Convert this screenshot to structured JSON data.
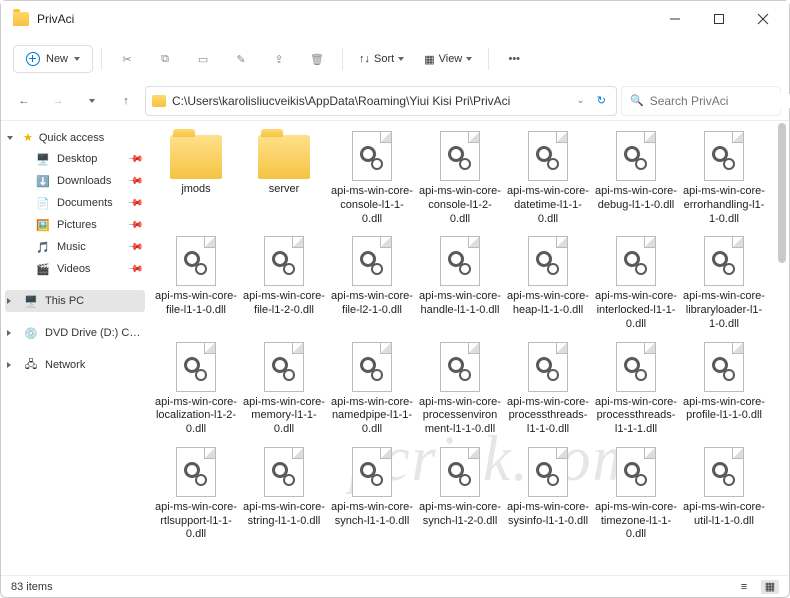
{
  "window": {
    "title": "PrivAci"
  },
  "toolbar": {
    "new_label": "New",
    "sort_label": "Sort",
    "view_label": "View"
  },
  "address": {
    "path": "C:\\Users\\karolisliucveikis\\AppData\\Roaming\\Yiui Kisi Pri\\PrivAci"
  },
  "search": {
    "placeholder": "Search PrivAci"
  },
  "sidebar": {
    "quick": "Quick access",
    "items": [
      {
        "label": "Desktop",
        "icon": "desktop"
      },
      {
        "label": "Downloads",
        "icon": "downloads"
      },
      {
        "label": "Documents",
        "icon": "documents"
      },
      {
        "label": "Pictures",
        "icon": "pictures"
      },
      {
        "label": "Music",
        "icon": "music"
      },
      {
        "label": "Videos",
        "icon": "videos"
      }
    ],
    "thispc": "This PC",
    "dvd": "DVD Drive (D:) CCCC",
    "network": "Network"
  },
  "files": [
    {
      "type": "folder",
      "name": "jmods"
    },
    {
      "type": "folder",
      "name": "server"
    },
    {
      "type": "dll",
      "name": "api-ms-win-core-console-l1-1-0.dll"
    },
    {
      "type": "dll",
      "name": "api-ms-win-core-console-l1-2-0.dll"
    },
    {
      "type": "dll",
      "name": "api-ms-win-core-datetime-l1-1-0.dll"
    },
    {
      "type": "dll",
      "name": "api-ms-win-core-debug-l1-1-0.dll"
    },
    {
      "type": "dll",
      "name": "api-ms-win-core-errorhandling-l1-1-0.dll"
    },
    {
      "type": "dll",
      "name": "api-ms-win-core-file-l1-1-0.dll"
    },
    {
      "type": "dll",
      "name": "api-ms-win-core-file-l1-2-0.dll"
    },
    {
      "type": "dll",
      "name": "api-ms-win-core-file-l2-1-0.dll"
    },
    {
      "type": "dll",
      "name": "api-ms-win-core-handle-l1-1-0.dll"
    },
    {
      "type": "dll",
      "name": "api-ms-win-core-heap-l1-1-0.dll"
    },
    {
      "type": "dll",
      "name": "api-ms-win-core-interlocked-l1-1-0.dll"
    },
    {
      "type": "dll",
      "name": "api-ms-win-core-libraryloader-l1-1-0.dll"
    },
    {
      "type": "dll",
      "name": "api-ms-win-core-localization-l1-2-0.dll"
    },
    {
      "type": "dll",
      "name": "api-ms-win-core-memory-l1-1-0.dll"
    },
    {
      "type": "dll",
      "name": "api-ms-win-core-namedpipe-l1-1-0.dll"
    },
    {
      "type": "dll",
      "name": "api-ms-win-core-processenvironment-l1-1-0.dll"
    },
    {
      "type": "dll",
      "name": "api-ms-win-core-processthreads-l1-1-0.dll"
    },
    {
      "type": "dll",
      "name": "api-ms-win-core-processthreads-l1-1-1.dll"
    },
    {
      "type": "dll",
      "name": "api-ms-win-core-profile-l1-1-0.dll"
    },
    {
      "type": "dll",
      "name": "api-ms-win-core-rtlsupport-l1-1-0.dll"
    },
    {
      "type": "dll",
      "name": "api-ms-win-core-string-l1-1-0.dll"
    },
    {
      "type": "dll",
      "name": "api-ms-win-core-synch-l1-1-0.dll"
    },
    {
      "type": "dll",
      "name": "api-ms-win-core-synch-l1-2-0.dll"
    },
    {
      "type": "dll",
      "name": "api-ms-win-core-sysinfo-l1-1-0.dll"
    },
    {
      "type": "dll",
      "name": "api-ms-win-core-timezone-l1-1-0.dll"
    },
    {
      "type": "dll",
      "name": "api-ms-win-core-util-l1-1-0.dll"
    }
  ],
  "status": {
    "count": "83 items"
  },
  "icon_colors": {
    "desktop": "#1e90d4",
    "downloads": "#1e90d4",
    "documents": "#1e90d4",
    "pictures": "#1e90d4",
    "music": "#b53ea4",
    "videos": "#b53ea4"
  }
}
